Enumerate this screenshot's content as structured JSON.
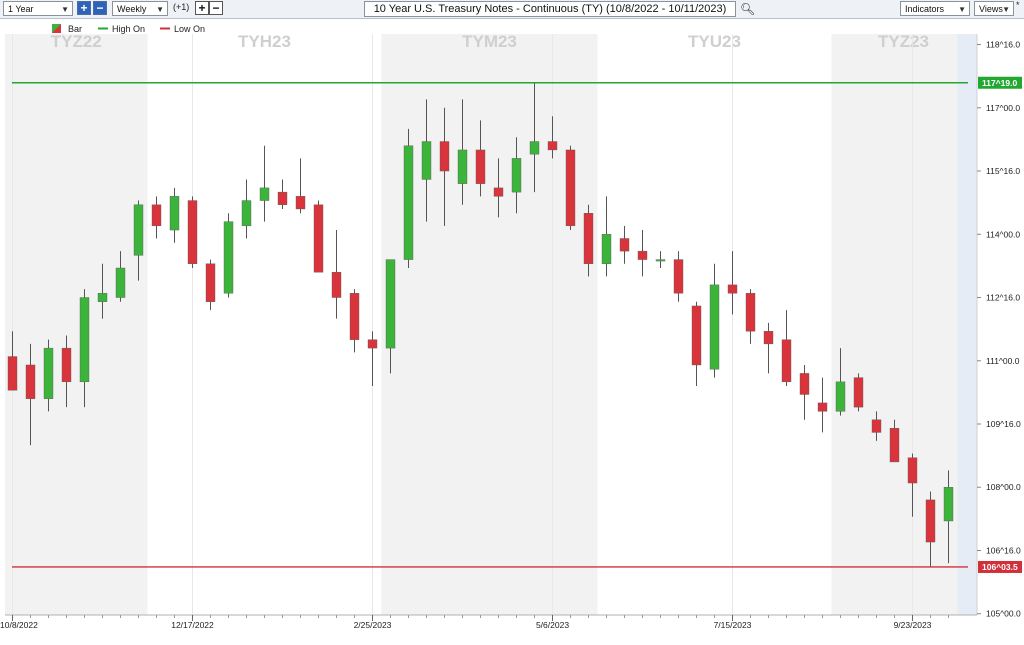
{
  "toolbar": {
    "period_select": "1 Year",
    "zoom_in_label": "+",
    "zoom_out_label": "−",
    "interval_select": "Weekly",
    "offset_label": "(+1)",
    "step_in_label": "+",
    "step_out_label": "−",
    "title": "10 Year U.S. Treasury Notes - Continuous (TY) (10/8/2022 - 10/11/2023)",
    "search_icon": "magnifier-icon",
    "indicators_label": "Indicators",
    "views_label": "Views",
    "views_marker": "*"
  },
  "legend": {
    "bar_label": "Bar",
    "high_label": "High On",
    "low_label": "Low On",
    "high_color": "#22a830",
    "low_color": "#d0303a"
  },
  "colors": {
    "up": "#3cb43c",
    "down": "#d9343c",
    "contract_shade": "#f2f2f2",
    "last_bar_shade": "#e6ecf6"
  },
  "chart_data": {
    "type": "candlestick",
    "title": "10 Year U.S. Treasury Notes - Continuous (TY) (10/8/2022 - 10/11/2023)",
    "ylim": [
      104.97,
      118.75
    ],
    "y_ticks": [
      {
        "value": 105.0,
        "label": "105^00.0"
      },
      {
        "value": 106.5,
        "label": "106^16.0"
      },
      {
        "value": 108.0,
        "label": "108^00.0"
      },
      {
        "value": 109.5,
        "label": "109^16.0"
      },
      {
        "value": 111.0,
        "label": "111^00.0"
      },
      {
        "value": 112.5,
        "label": "112^16.0"
      },
      {
        "value": 114.0,
        "label": "114^00.0"
      },
      {
        "value": 115.5,
        "label": "115^16.0"
      },
      {
        "value": 117.0,
        "label": "117^00.0"
      },
      {
        "value": 118.5,
        "label": "118^16.0"
      }
    ],
    "x_ticks": [
      {
        "index": 0,
        "label": "10/8/2022"
      },
      {
        "index": 10,
        "label": "12/17/2022"
      },
      {
        "index": 20,
        "label": "2/25/2023"
      },
      {
        "index": 30,
        "label": "5/6/2023"
      },
      {
        "index": 40,
        "label": "7/15/2023"
      },
      {
        "index": 50,
        "label": "9/23/2023"
      }
    ],
    "contract_bands": [
      {
        "label": "TYZ22",
        "start": 0,
        "end": 7,
        "shaded": true
      },
      {
        "label": "TYH23",
        "start": 8,
        "end": 20,
        "shaded": false
      },
      {
        "label": "TYM23",
        "start": 21,
        "end": 32,
        "shaded": true
      },
      {
        "label": "TYU23",
        "start": 33,
        "end": 45,
        "shaded": false
      },
      {
        "label": "TYZ23",
        "start": 46,
        "end": 53,
        "shaded": true
      }
    ],
    "high_line": {
      "value": 117.59375,
      "label": "117^19.0"
    },
    "low_line": {
      "value": 106.109375,
      "label": "106^03.5"
    },
    "candles": [
      {
        "o": 111.1,
        "h": 111.7,
        "l": 110.3,
        "c": 110.3
      },
      {
        "o": 110.9,
        "h": 111.4,
        "l": 109.0,
        "c": 110.1
      },
      {
        "o": 110.1,
        "h": 111.5,
        "l": 109.8,
        "c": 111.3
      },
      {
        "o": 111.3,
        "h": 111.6,
        "l": 109.9,
        "c": 110.5
      },
      {
        "o": 110.5,
        "h": 112.7,
        "l": 109.9,
        "c": 112.5
      },
      {
        "o": 112.4,
        "h": 113.3,
        "l": 112.0,
        "c": 112.6
      },
      {
        "o": 112.5,
        "h": 113.6,
        "l": 112.4,
        "c": 113.2
      },
      {
        "o": 113.5,
        "h": 114.8,
        "l": 112.9,
        "c": 114.7
      },
      {
        "o": 114.7,
        "h": 114.9,
        "l": 113.9,
        "c": 114.2
      },
      {
        "o": 114.1,
        "h": 115.1,
        "l": 113.8,
        "c": 114.9
      },
      {
        "o": 114.8,
        "h": 114.9,
        "l": 113.2,
        "c": 113.3
      },
      {
        "o": 113.3,
        "h": 113.4,
        "l": 112.2,
        "c": 112.4
      },
      {
        "o": 112.6,
        "h": 114.5,
        "l": 112.5,
        "c": 114.3
      },
      {
        "o": 114.2,
        "h": 115.3,
        "l": 113.9,
        "c": 114.8
      },
      {
        "o": 114.8,
        "h": 116.1,
        "l": 114.3,
        "c": 115.1
      },
      {
        "o": 115.0,
        "h": 115.3,
        "l": 114.6,
        "c": 114.7
      },
      {
        "o": 114.9,
        "h": 115.8,
        "l": 114.5,
        "c": 114.6
      },
      {
        "o": 114.7,
        "h": 114.8,
        "l": 113.1,
        "c": 113.1
      },
      {
        "o": 113.1,
        "h": 114.1,
        "l": 112.0,
        "c": 112.5
      },
      {
        "o": 112.6,
        "h": 112.7,
        "l": 111.2,
        "c": 111.5
      },
      {
        "o": 111.5,
        "h": 111.7,
        "l": 110.4,
        "c": 111.3
      },
      {
        "o": 111.3,
        "h": 113.4,
        "l": 110.7,
        "c": 113.4
      },
      {
        "o": 113.4,
        "h": 116.5,
        "l": 113.2,
        "c": 116.1
      },
      {
        "o": 115.3,
        "h": 117.2,
        "l": 114.3,
        "c": 116.2
      },
      {
        "o": 116.2,
        "h": 117.0,
        "l": 114.2,
        "c": 115.5
      },
      {
        "o": 115.2,
        "h": 117.2,
        "l": 114.7,
        "c": 116.0
      },
      {
        "o": 116.0,
        "h": 116.7,
        "l": 114.9,
        "c": 115.2
      },
      {
        "o": 115.1,
        "h": 115.8,
        "l": 114.4,
        "c": 114.9
      },
      {
        "o": 115.0,
        "h": 116.3,
        "l": 114.5,
        "c": 115.8
      },
      {
        "o": 115.9,
        "h": 117.6,
        "l": 115.0,
        "c": 116.2
      },
      {
        "o": 116.2,
        "h": 116.8,
        "l": 115.8,
        "c": 116.0
      },
      {
        "o": 116.0,
        "h": 116.1,
        "l": 114.1,
        "c": 114.2
      },
      {
        "o": 114.5,
        "h": 114.7,
        "l": 113.0,
        "c": 113.3
      },
      {
        "o": 113.3,
        "h": 114.9,
        "l": 113.0,
        "c": 114.0
      },
      {
        "o": 113.9,
        "h": 114.2,
        "l": 113.3,
        "c": 113.6
      },
      {
        "o": 113.6,
        "h": 114.1,
        "l": 113.0,
        "c": 113.4
      },
      {
        "o": 113.4,
        "h": 113.6,
        "l": 113.2,
        "c": 113.4
      },
      {
        "o": 113.4,
        "h": 113.6,
        "l": 112.4,
        "c": 112.6
      },
      {
        "o": 112.3,
        "h": 112.4,
        "l": 110.4,
        "c": 110.9
      },
      {
        "o": 110.8,
        "h": 113.3,
        "l": 110.6,
        "c": 112.8
      },
      {
        "o": 112.8,
        "h": 113.6,
        "l": 112.1,
        "c": 112.6
      },
      {
        "o": 112.6,
        "h": 112.7,
        "l": 111.4,
        "c": 111.7
      },
      {
        "o": 111.7,
        "h": 111.9,
        "l": 110.7,
        "c": 111.4
      },
      {
        "o": 111.5,
        "h": 112.2,
        "l": 110.4,
        "c": 110.5
      },
      {
        "o": 110.7,
        "h": 110.9,
        "l": 109.6,
        "c": 110.2
      },
      {
        "o": 110.0,
        "h": 110.6,
        "l": 109.3,
        "c": 109.8
      },
      {
        "o": 109.8,
        "h": 111.3,
        "l": 109.7,
        "c": 110.5
      },
      {
        "o": 110.6,
        "h": 110.7,
        "l": 109.8,
        "c": 109.9
      },
      {
        "o": 109.6,
        "h": 109.8,
        "l": 109.1,
        "c": 109.3
      },
      {
        "o": 109.4,
        "h": 109.6,
        "l": 108.6,
        "c": 108.6
      },
      {
        "o": 108.7,
        "h": 108.8,
        "l": 107.3,
        "c": 108.1
      },
      {
        "o": 107.7,
        "h": 107.9,
        "l": 106.1,
        "c": 106.7
      },
      {
        "o": 107.2,
        "h": 108.4,
        "l": 106.2,
        "c": 108.0
      }
    ]
  }
}
